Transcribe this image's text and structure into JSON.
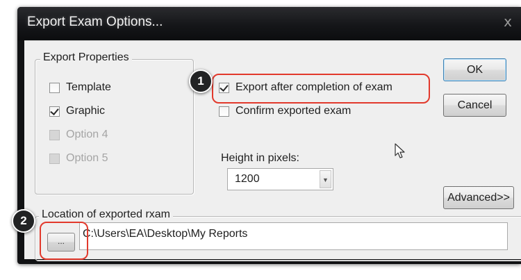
{
  "dialog": {
    "title": "Export Exam Options...",
    "close_glyph": "x"
  },
  "export_properties": {
    "legend": "Export Properties",
    "options": [
      {
        "label": "Template",
        "checked": false,
        "enabled": true
      },
      {
        "label": "Graphic",
        "checked": true,
        "enabled": true
      },
      {
        "label": "Option 4",
        "checked": false,
        "enabled": false
      },
      {
        "label": "Option 5",
        "checked": false,
        "enabled": false
      }
    ]
  },
  "export_after_completion": {
    "label": "Export after completion of exam",
    "checked": true
  },
  "confirm_exported": {
    "label": "Confirm exported exam",
    "checked": false
  },
  "height": {
    "label": "Height in pixels:",
    "value": "1200"
  },
  "buttons": {
    "ok": "OK",
    "cancel": "Cancel",
    "advanced": "Advanced>>",
    "browse": "..."
  },
  "location": {
    "legend": "Location of exported rxam",
    "path": "C:\\Users\\EA\\Desktop\\My Reports"
  },
  "annotations": {
    "marker_1": "1",
    "marker_2": "2",
    "highlight_color": "#e2392c"
  },
  "icons": {
    "close": "close-icon",
    "dropdown": "chevron-down-icon",
    "cursor": "mouse-pointer-icon"
  }
}
